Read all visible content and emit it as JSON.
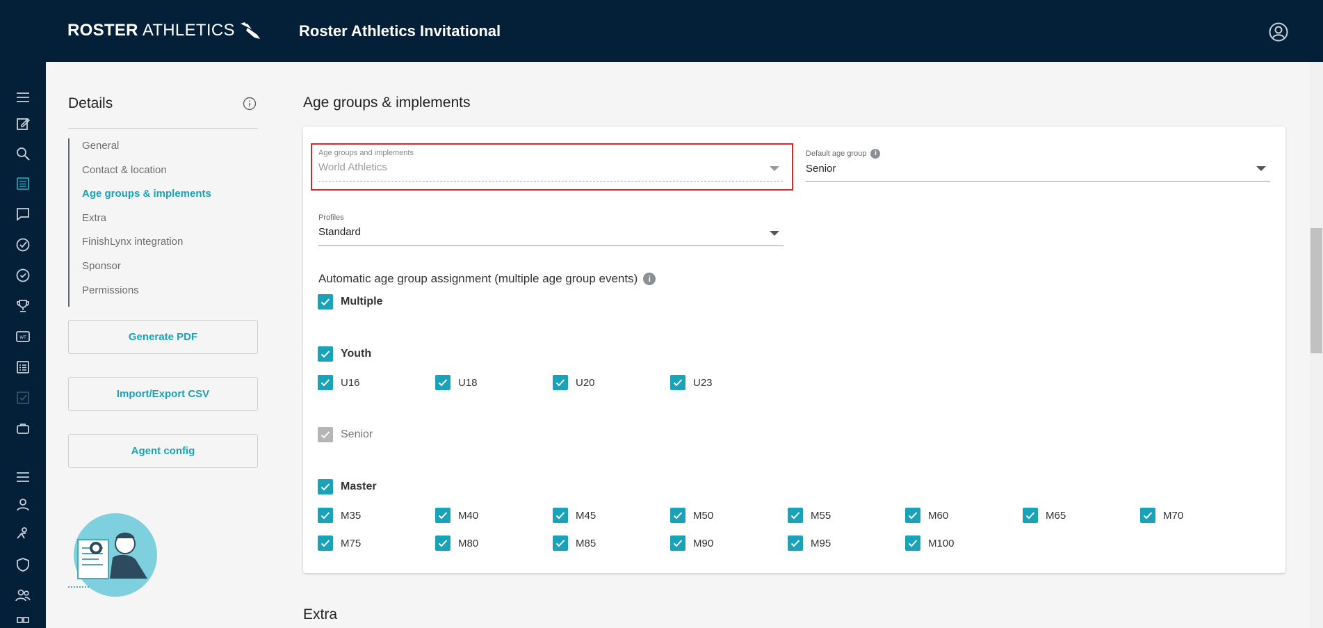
{
  "header": {
    "logo_bold": "ROSTER",
    "logo_thin": "ATHLETICS",
    "title": "Roster Athletics Invitational",
    "account_icon": "account-circle-icon"
  },
  "rail_icons": [
    "menu-icon",
    "edit-icon",
    "search-icon",
    "list-icon",
    "chat-icon",
    "check-circle-icon",
    "check-circle-outline-icon",
    "trophy-icon",
    "scoreboard-icon",
    "results-list-icon",
    "checkbox-icon",
    "briefcase-icon",
    "menu-icon",
    "person-icon",
    "athlete-icon",
    "shield-icon",
    "group-icon",
    "grid-icon"
  ],
  "details": {
    "title": "Details",
    "nav": [
      {
        "label": "General",
        "active": false
      },
      {
        "label": "Contact & location",
        "active": false
      },
      {
        "label": "Age groups & implements",
        "active": true
      },
      {
        "label": "Extra",
        "active": false
      },
      {
        "label": "FinishLynx integration",
        "active": false
      },
      {
        "label": "Sponsor",
        "active": false
      },
      {
        "label": "Permissions",
        "active": false
      }
    ],
    "buttons": {
      "generate_pdf": "Generate PDF",
      "import_export": "Import/Export CSV",
      "agent_config": "Agent config"
    }
  },
  "main": {
    "section_title": "Age groups & implements",
    "age_groups_field": {
      "label": "Age groups and implements",
      "value": "World Athletics"
    },
    "default_age_group": {
      "label": "Default age group",
      "value": "Senior"
    },
    "profiles": {
      "label": "Profiles",
      "value": "Standard"
    },
    "auto_assign_label": "Automatic age group assignment (multiple age group events)",
    "multiple": {
      "label": "Multiple",
      "checked": true
    },
    "youth": {
      "label": "Youth",
      "checked": true,
      "items": [
        "U16",
        "U18",
        "U20",
        "U23"
      ]
    },
    "senior": {
      "label": "Senior",
      "checked": true,
      "disabled": true
    },
    "master": {
      "label": "Master",
      "checked": true,
      "row1": [
        "M35",
        "M40",
        "M45",
        "M50",
        "M55",
        "M60",
        "M65",
        "M70"
      ],
      "row2": [
        "M75",
        "M80",
        "M85",
        "M90",
        "M95",
        "M100"
      ]
    },
    "next_section_title": "Extra"
  },
  "colors": {
    "header_bg": "#032038",
    "accent": "#1aa3b8",
    "highlight": "#e62020"
  }
}
